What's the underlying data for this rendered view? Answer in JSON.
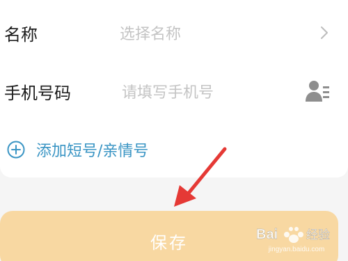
{
  "form": {
    "name_label": "名称",
    "name_placeholder": "选择名称",
    "phone_label": "手机号码",
    "phone_placeholder": "请填写手机号",
    "add_short_number_label": "添加短号/亲情号"
  },
  "actions": {
    "save_label": "保存"
  },
  "watermark": {
    "brand_text": "Bai 经验",
    "url": "jingyan.baidu.com"
  },
  "icons": {
    "name_row_trailing": "chevron-right-icon",
    "phone_row_trailing": "contact-book-icon",
    "add_row_leading": "plus-circle-icon"
  },
  "colors": {
    "accent": "#3a95c4",
    "save_button_bg": "#f8d8a2",
    "annotation_arrow": "#e53935",
    "placeholder_text": "#c4c4c4"
  }
}
